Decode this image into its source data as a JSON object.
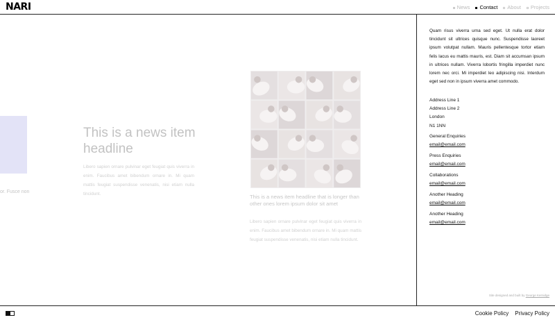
{
  "header": {
    "logo": "NARI",
    "nav": [
      {
        "label": "News",
        "active": false
      },
      {
        "label": "Contact",
        "active": true
      },
      {
        "label": "About",
        "active": false
      },
      {
        "label": "Projects",
        "active": false
      }
    ]
  },
  "main": {
    "partial_text": "or. Fusce non",
    "news_items": [
      {
        "headline": "This is a news item headline",
        "body": "Libero sapien ornare pulvinar eget feugiat quis viverra in enim. Faucibus amet bibendum ornare in. Mi quam mattis feugiat suspendisse venenatis, nisi etiam nulla tincidunt."
      },
      {
        "headline": "This is a news item headline that is longer than other ones lorem ipsum dolor sit amet",
        "body": "Libero sapien ornare pulvinar eget feugiat quis viverra in enim. Faucibus amet bibendum ornare in. Mi quam mattis feugiat suspendisse venenatis, nisi etiam nulla tincidunt."
      }
    ]
  },
  "panel": {
    "intro": "Quam risus viverra urna sed eget. Ut nulla erat dolor tincidunt sit ultrices quisque nunc. Suspendisse laoreet ipsum volutpat nullam. Mauris pellentesque tortor etiam felis lacus eu mattis mauris, est. Diam sit accumsan ipsum in ultrices nullam. Viverra lobortis fringilla imperdiet nunc lorem nec orci. Mi imperdiet leo adipiscing nisi. Interdum eget sed non in ipsum viverra amet commodo.",
    "address": [
      "Address Line 1",
      "Address Line 2",
      "London",
      "N1 1NN"
    ],
    "contacts": [
      {
        "heading": "General Enquiries",
        "email": "email@email.com"
      },
      {
        "heading": "Press Enquiries",
        "email": "email@email.com"
      },
      {
        "heading": "Collaborations",
        "email": "email@email.com"
      },
      {
        "heading": "Another Heading",
        "email": "email@email.com"
      },
      {
        "heading": "Another Heading",
        "email": "email@email.com"
      }
    ],
    "credit_prefix": "Site designed and built by",
    "credit_name": "George Kernidge"
  },
  "footer": {
    "cookie": "Cookie Policy",
    "privacy": "Privacy Policy"
  },
  "colors": {
    "border": "#222222",
    "accent_block": "#e3e3f7",
    "faded_text": "#c2c2c2"
  }
}
